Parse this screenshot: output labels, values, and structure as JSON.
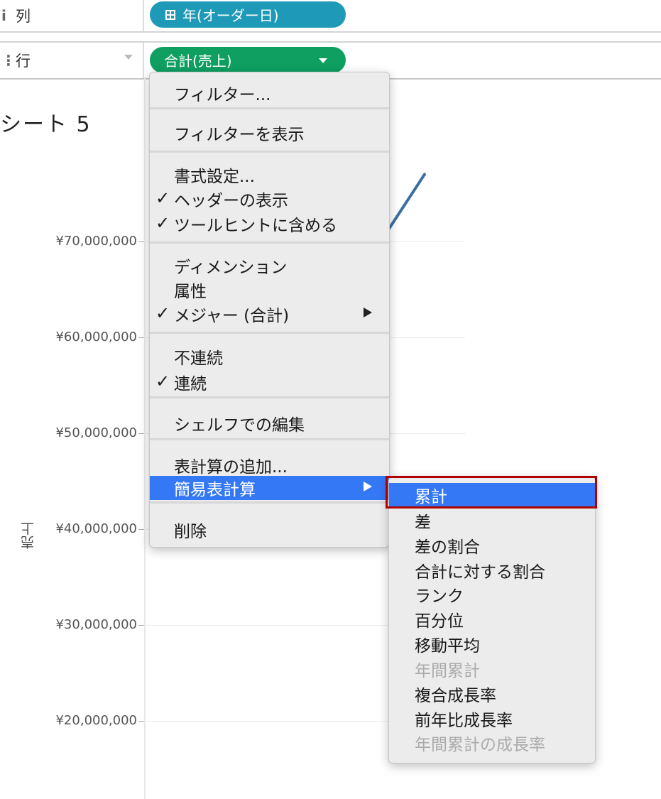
{
  "shelves": {
    "columns": {
      "icon": "i",
      "label": "列",
      "pill": "年(オーダー日)"
    },
    "rows": {
      "icon": "⋮",
      "label": "行",
      "pill": "合計(売上)"
    }
  },
  "sheet": {
    "title": "シート 5"
  },
  "chart_data": {
    "type": "line",
    "ylabel": "売上",
    "yticks": [
      "¥70,000,000",
      "¥60,000,000",
      "¥50,000,000",
      "¥40,000,000",
      "¥30,000,000",
      "¥20,000,000"
    ],
    "series": [
      {
        "values": [
          38500000,
          77000000
        ]
      }
    ],
    "colors": {
      "line": "#3a6fa5"
    }
  },
  "context_menu": {
    "items": [
      {
        "label": "フィルター..."
      },
      {
        "label": "フィルターを表示"
      },
      {
        "label": "書式設定..."
      },
      {
        "label": "ヘッダーの表示",
        "checked": true
      },
      {
        "label": "ツールヒントに含める",
        "checked": true
      },
      {
        "label": "ディメンション"
      },
      {
        "label": "属性"
      },
      {
        "label": "メジャー (合計)",
        "checked": true,
        "submenu": true
      },
      {
        "label": "不連続"
      },
      {
        "label": "連続",
        "checked": true
      },
      {
        "label": "シェルフでの編集"
      },
      {
        "label": "表計算の追加..."
      },
      {
        "label": "簡易表計算",
        "submenu": true,
        "highlighted": true
      },
      {
        "label": "削除"
      }
    ],
    "check_glyph": "✓"
  },
  "submenu": {
    "items": [
      {
        "label": "累計",
        "highlighted": true
      },
      {
        "label": "差"
      },
      {
        "label": "差の割合"
      },
      {
        "label": "合計に対する割合"
      },
      {
        "label": "ランク"
      },
      {
        "label": "百分位"
      },
      {
        "label": "移動平均"
      },
      {
        "label": "年間累計",
        "disabled": true
      },
      {
        "label": "複合成長率"
      },
      {
        "label": "前年比成長率"
      },
      {
        "label": "年間累計の成長率",
        "disabled": true
      }
    ]
  },
  "colors": {
    "highlight": "#3478f6",
    "annotation": "#b00000",
    "columns_pill": "#1e9ab8",
    "rows_pill": "#0e9f61"
  }
}
